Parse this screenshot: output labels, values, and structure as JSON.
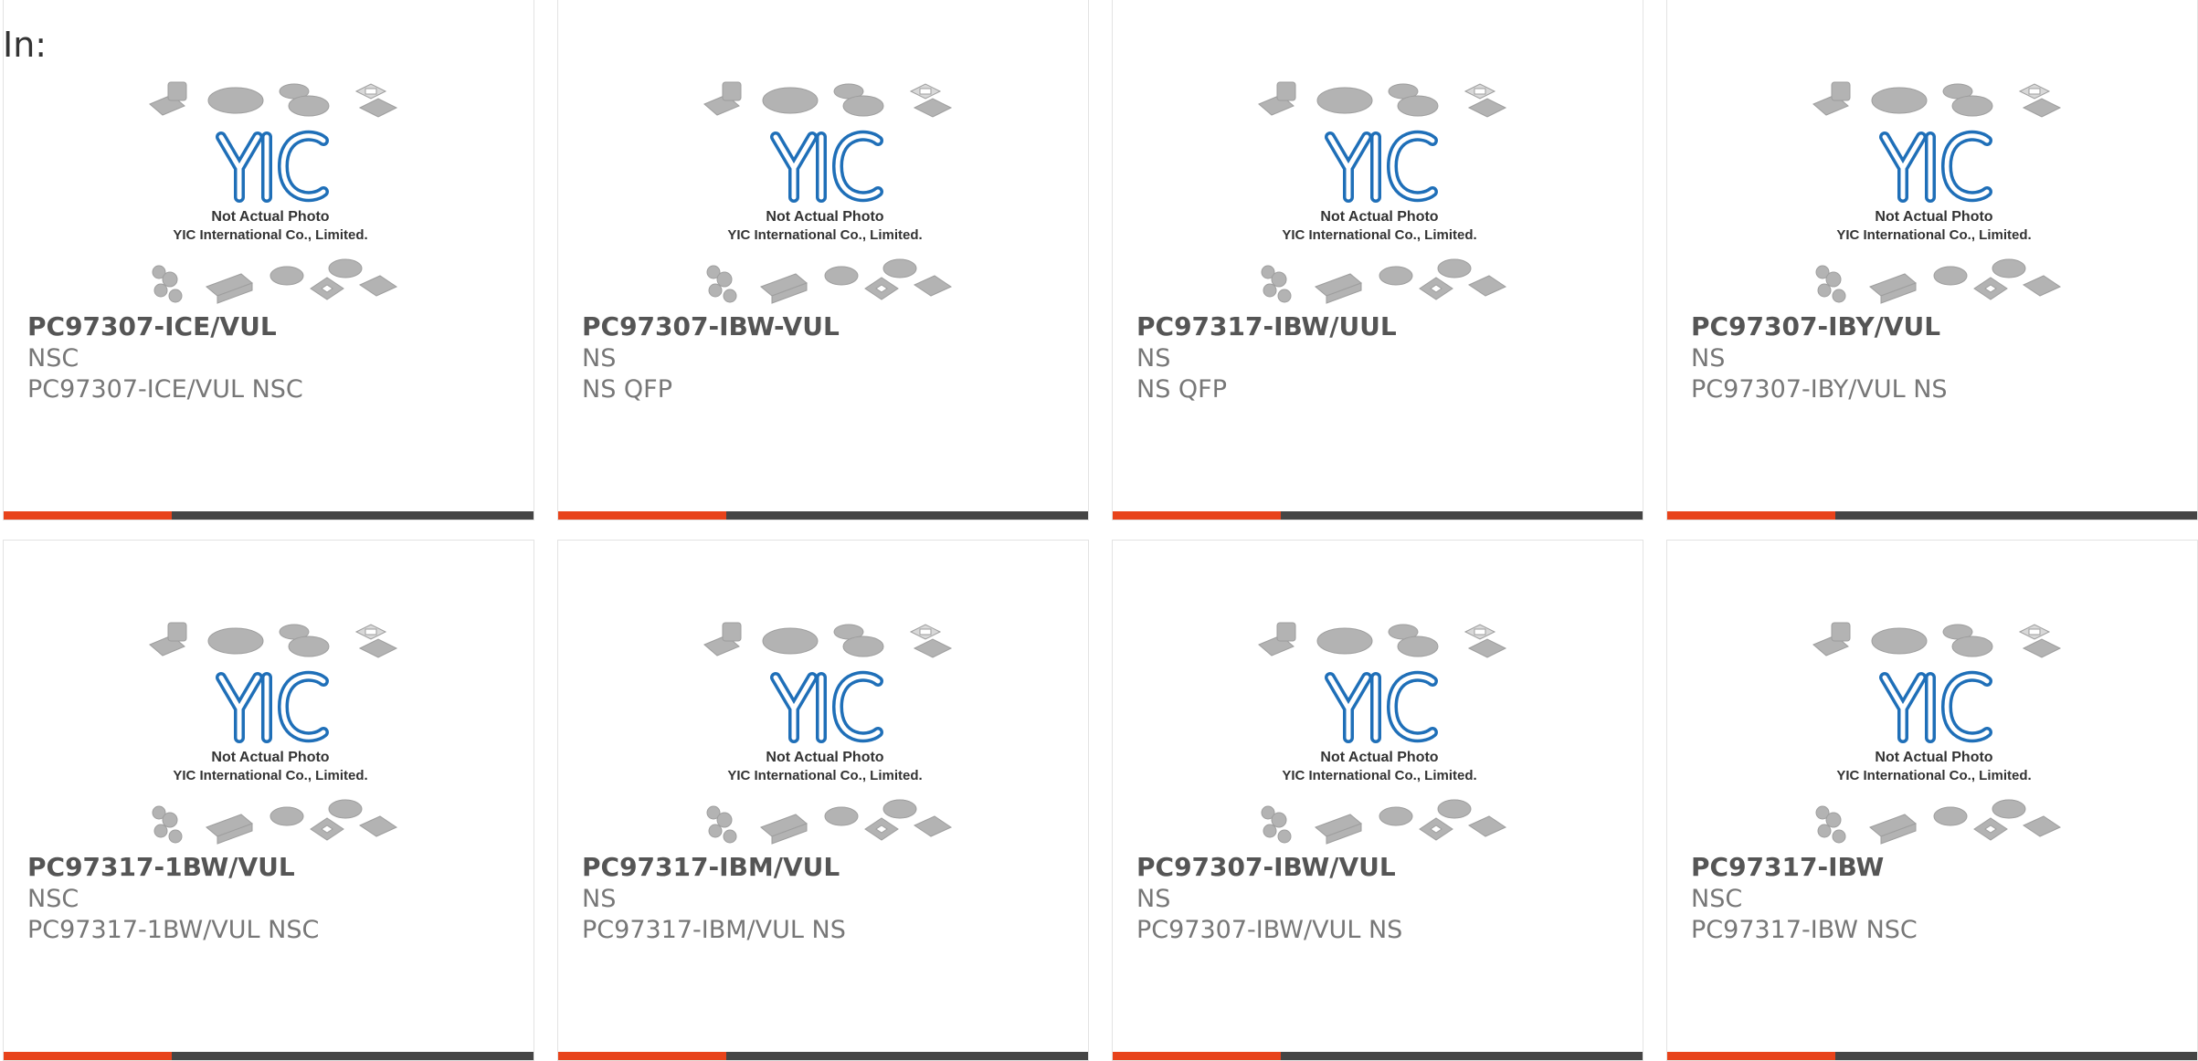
{
  "header": {
    "label": "In:"
  },
  "thumbnail": {
    "caption_line1": "Not Actual Photo",
    "caption_line2": "YIC International Co., Limited.",
    "logo_text": "YIC"
  },
  "colors": {
    "accent": "#e8431b",
    "bar": "#454545",
    "logo_blue": "#1f6fb8",
    "chip_gray": "#b3b3b3"
  },
  "products": [
    {
      "part": "PC97307-ICE/VUL",
      "manufacturer": "NSC",
      "description": "PC97307-ICE/VUL NSC"
    },
    {
      "part": "PC97307-IBW-VUL",
      "manufacturer": "NS",
      "description": "NS QFP"
    },
    {
      "part": "PC97317-IBW/UUL",
      "manufacturer": "NS",
      "description": "NS QFP"
    },
    {
      "part": "PC97307-IBY/VUL",
      "manufacturer": "NS",
      "description": "PC97307-IBY/VUL NS"
    },
    {
      "part": "PC97317-1BW/VUL",
      "manufacturer": "NSC",
      "description": "PC97317-1BW/VUL NSC"
    },
    {
      "part": "PC97317-IBM/VUL",
      "manufacturer": "NS",
      "description": "PC97317-IBM/VUL NS"
    },
    {
      "part": "PC97307-IBW/VUL",
      "manufacturer": "NS",
      "description": "PC97307-IBW/VUL NS"
    },
    {
      "part": "PC97317-IBW",
      "manufacturer": "NSC",
      "description": "PC97317-IBW NSC"
    }
  ]
}
